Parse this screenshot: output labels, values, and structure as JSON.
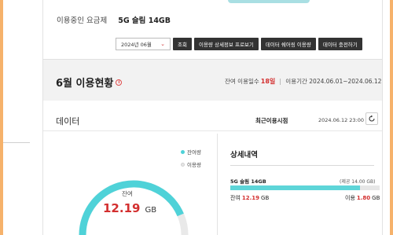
{
  "plan": {
    "label": "이용중인 요금제",
    "name": "5G 슬림 14GB"
  },
  "controls": {
    "month_select": "2024년 06월",
    "search_button": "조회",
    "detail_button": "이용량 상세정보 프로보기",
    "sharing_button": "데이터 쉐어링 이용량",
    "recharge_button": "데이터 충전하기"
  },
  "status": {
    "title": "6월 이용현황",
    "remaining_days_label": "잔여 이용일수",
    "remaining_days_value": "18일",
    "period_label": "이용기간 2024.06.01~2024.06.12"
  },
  "data_section": {
    "title": "데이터",
    "recent_label": "최근이용시점",
    "recent_time": "2024.06.12 23:00",
    "legend_remaining": "잔여량",
    "legend_used": "이용량",
    "gauge_label": "잔여",
    "gauge_value": "12.19",
    "gauge_unit": "GB",
    "remaining_fraction": 0.871
  },
  "detail": {
    "title": "상세내역",
    "plan_name": "5G 슬림 14GB",
    "offered": "(제공 14.00 GB)",
    "remaining_label": "잔여",
    "remaining_value": "12.19",
    "remaining_unit": "GB",
    "used_label": "이용",
    "used_value": "1.80",
    "used_unit": "GB"
  },
  "colors": {
    "accent": "#4fd2d8",
    "highlight": "#d32f2f",
    "frame": "#f6b26b"
  }
}
